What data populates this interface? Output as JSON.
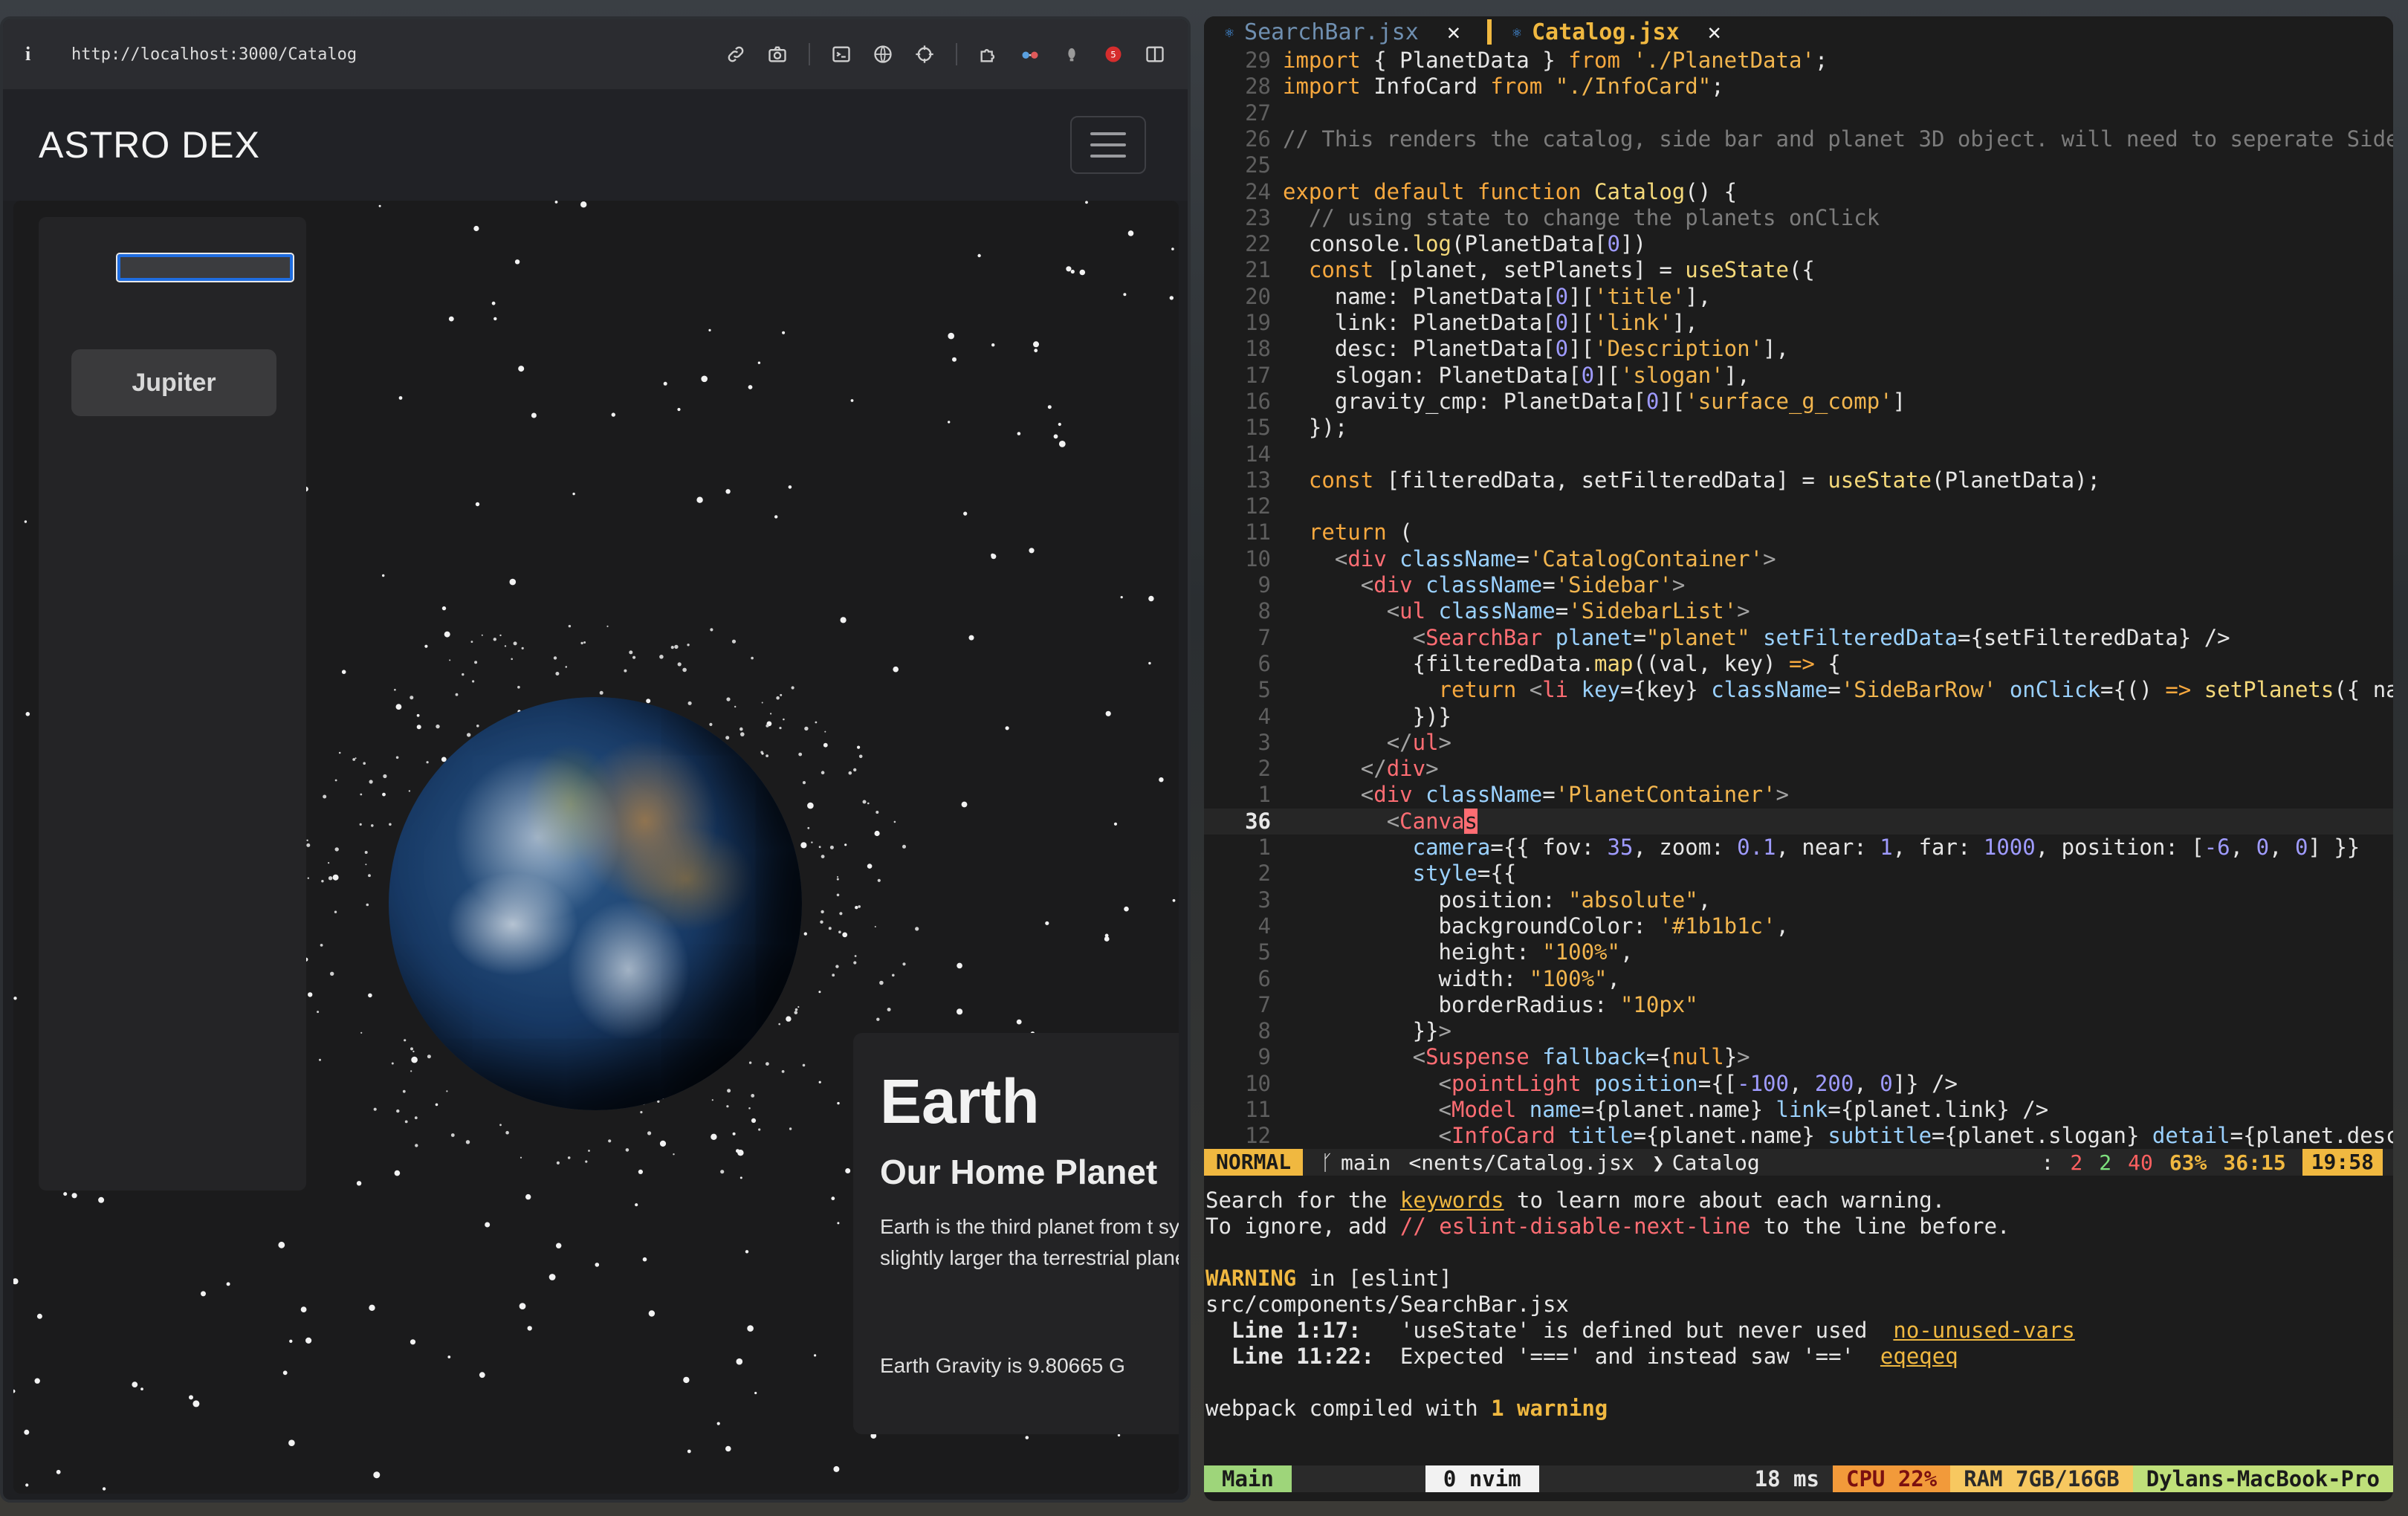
{
  "browser": {
    "url": "http://localhost:3000/Catalog",
    "tools": [
      "link-icon",
      "camera-icon",
      "terminal-icon",
      "globe-icon",
      "crosshair-icon",
      "extension-icon",
      "glasses-icon",
      "bulb-icon",
      "record-icon",
      "sidebar-icon"
    ]
  },
  "app": {
    "brand": "ASTRO DEX",
    "search_value": "",
    "sidebar_items": [
      "Jupiter"
    ],
    "info": {
      "title": "Earth",
      "subtitle": "Our Home Planet",
      "description": "Earth is the third planet from the Sun and the only place known in the universe to be inhabited by life. Just slightly larger than Venus, it is the largest of the four terrestrial planets.",
      "desc_visible": "Earth is the third planet from t system. Just slightly larger tha terrestrial planets.",
      "gravity": "Earth Gravity is 9.80665 G"
    }
  },
  "editor": {
    "tabs": [
      {
        "name": "SearchBar.jsx",
        "active": false
      },
      {
        "name": "Catalog.jsx",
        "active": true
      }
    ],
    "lines": [
      {
        "n": "29",
        "html": "<span class='kw'>import</span> { PlanetData } <span class='kw'>from</span> <span class='st'>'./PlanetData'</span>;"
      },
      {
        "n": "28",
        "html": "<span class='kw'>import</span> InfoCard <span class='kw'>from</span> <span class='st'>\"./InfoCard\"</span>;"
      },
      {
        "n": "27",
        "html": ""
      },
      {
        "n": "26",
        "html": "<span class='cm'>// This renders the catalog, side bar and planet 3D object. will need to seperate Side</span>"
      },
      {
        "n": "25",
        "html": ""
      },
      {
        "n": "24",
        "html": "<span class='kw'>export default function</span> <span class='fn'>Catalog</span>() {"
      },
      {
        "n": "23",
        "html": "  <span class='cm'>// using state to change the planets onClick</span>"
      },
      {
        "n": "22",
        "html": "  console.<span class='fn'>log</span>(PlanetData[<span class='nm'>0</span>])"
      },
      {
        "n": "21",
        "html": "  <span class='kw'>const</span> [planet, setPlanets] = <span class='fn'>useState</span>({"
      },
      {
        "n": "20",
        "html": "    name: PlanetData[<span class='nm'>0</span>][<span class='st'>'title'</span>],"
      },
      {
        "n": "19",
        "html": "    link: PlanetData[<span class='nm'>0</span>][<span class='st'>'link'</span>],"
      },
      {
        "n": "18",
        "html": "    desc: PlanetData[<span class='nm'>0</span>][<span class='st'>'Description'</span>],"
      },
      {
        "n": "17",
        "html": "    slogan: PlanetData[<span class='nm'>0</span>][<span class='st'>'slogan'</span>],"
      },
      {
        "n": "16",
        "html": "    gravity_cmp: PlanetData[<span class='nm'>0</span>][<span class='st'>'surface_g_comp'</span>]"
      },
      {
        "n": "15",
        "html": "  });"
      },
      {
        "n": "14",
        "html": ""
      },
      {
        "n": "13",
        "html": "  <span class='kw'>const</span> [filteredData, setFilteredData] = <span class='fn'>useState</span>(PlanetData);"
      },
      {
        "n": "12",
        "html": ""
      },
      {
        "n": "11",
        "html": "  <span class='kw'>return</span> ("
      },
      {
        "n": "10",
        "html": "    <span class='pu'>&lt;</span><span class='tg'>div</span> <span class='at'>className</span>=<span class='st'>'CatalogContainer'</span><span class='pu'>&gt;</span>"
      },
      {
        "n": "9",
        "html": "      <span class='pu'>&lt;</span><span class='tg'>div</span> <span class='at'>className</span>=<span class='st'>'Sidebar'</span><span class='pu'>&gt;</span>"
      },
      {
        "n": "8",
        "html": "        <span class='pu'>&lt;</span><span class='tg'>ul</span> <span class='at'>className</span>=<span class='st'>'SidebarList'</span><span class='pu'>&gt;</span>"
      },
      {
        "n": "7",
        "html": "          <span class='pu'>&lt;</span><span class='tg'>SearchBar</span> <span class='at'>planet</span>=<span class='st'>\"planet\"</span> <span class='at'>setFilteredData</span>={setFilteredData} /&gt;"
      },
      {
        "n": "6",
        "html": "          {filteredData.<span class='fn'>map</span>((val, key) <span class='kw'>=&gt;</span> {"
      },
      {
        "n": "5",
        "html": "            <span class='kw'>return</span> <span class='pu'>&lt;</span><span class='tg'>li</span> <span class='at'>key</span>={key} <span class='at'>className</span>=<span class='st'>'SideBarRow'</span> <span class='at'>onClick</span>={() <span class='kw'>=&gt;</span> <span class='fn'>setPlanets</span>({ na"
      },
      {
        "n": "4",
        "html": "          })}"
      },
      {
        "n": "3",
        "html": "        <span class='pu'>&lt;/</span><span class='tg'>ul</span><span class='pu'>&gt;</span>"
      },
      {
        "n": "2",
        "html": "      <span class='pu'>&lt;/</span><span class='tg'>div</span><span class='pu'>&gt;</span>"
      },
      {
        "n": "1",
        "html": "      <span class='pu'>&lt;</span><span class='tg'>div</span> <span class='at'>className</span>=<span class='st'>'PlanetContainer'</span><span class='pu'>&gt;</span>"
      },
      {
        "n": "36",
        "html": "        <span class='pu'>&lt;</span><span class='tg'>Canva</span><span style='background:#ff6d73;color:#1a1a1a'>s</span>",
        "cur": true
      },
      {
        "n": "1",
        "html": "          <span class='at'>camera</span>={{ fov: <span class='nm'>35</span>, zoom: <span class='nm'>0.1</span>, near: <span class='nm'>1</span>, far: <span class='nm'>1000</span>, position: [<span class='nm'>-6</span>, <span class='nm'>0</span>, <span class='nm'>0</span>] }}"
      },
      {
        "n": "2",
        "html": "          <span class='at'>style</span>={{"
      },
      {
        "n": "3",
        "html": "            position: <span class='st'>\"absolute\"</span>,"
      },
      {
        "n": "4",
        "html": "            backgroundColor: <span class='st'>'#1b1b1c'</span>,"
      },
      {
        "n": "5",
        "html": "            height: <span class='st'>\"100%\"</span>,"
      },
      {
        "n": "6",
        "html": "            width: <span class='st'>\"100%\"</span>,"
      },
      {
        "n": "7",
        "html": "            borderRadius: <span class='st'>\"10px\"</span>"
      },
      {
        "n": "8",
        "html": "          }}<span class='pu'>&gt;</span>"
      },
      {
        "n": "9",
        "html": "          <span class='pu'>&lt;</span><span class='tg'>Suspense</span> <span class='at'>fallback</span>={<span class='kw'>null</span>}<span class='pu'>&gt;</span>"
      },
      {
        "n": "10",
        "html": "            <span class='pu'>&lt;</span><span class='tg'>pointLight</span> <span class='at'>position</span>={[<span class='nm'>-100</span>, <span class='nm'>200</span>, <span class='nm'>0</span>]} /&gt;"
      },
      {
        "n": "11",
        "html": "            <span class='pu'>&lt;</span><span class='tg'>Model</span> <span class='at'>name</span>={planet.name} <span class='at'>link</span>={planet.link} /&gt;"
      },
      {
        "n": "12",
        "html": "            <span class='pu'>&lt;</span><span class='tg'>InfoCard</span> <span class='at'>title</span>={planet.name} <span class='at'>subtitle</span>={planet.slogan} <span class='at'>detail</span>={planet.desc"
      }
    ],
    "status": {
      "mode": "NORMAL",
      "branch": "main",
      "file": "<nents/Catalog.jsx",
      "symbol": "Catalog",
      "errors": "2",
      "hints": "2",
      "warnings": "40",
      "percent": "63%",
      "position": "36:15",
      "time": "19:58"
    }
  },
  "terminal": {
    "line1_a": "Search for the ",
    "line1_link": "keywords",
    "line1_b": " to learn more about each warning.",
    "line2_a": "To ignore, add ",
    "line2_code": "// eslint-disable-next-line",
    "line2_b": " to the line before.",
    "warn_label": "WARNING",
    "warn_rest": " in [eslint]",
    "file": "src/components/SearchBar.jsx",
    "issues": [
      {
        "where": "Line 1:17:",
        "msg": "'useState' is defined but never used",
        "rule": "no-unused-vars"
      },
      {
        "where": "Line 11:22:",
        "msg": "Expected '===' and instead saw '=='",
        "rule": "eqeqeq"
      }
    ],
    "compiled_a": "webpack compiled with ",
    "compiled_b": "1 warning"
  },
  "tmux": {
    "session": "Main",
    "window": "0 nvim",
    "latency": "18 ms",
    "cpu": "CPU 22%",
    "ram": "RAM 7GB/16GB",
    "host": "Dylans-MacBook-Pro"
  }
}
